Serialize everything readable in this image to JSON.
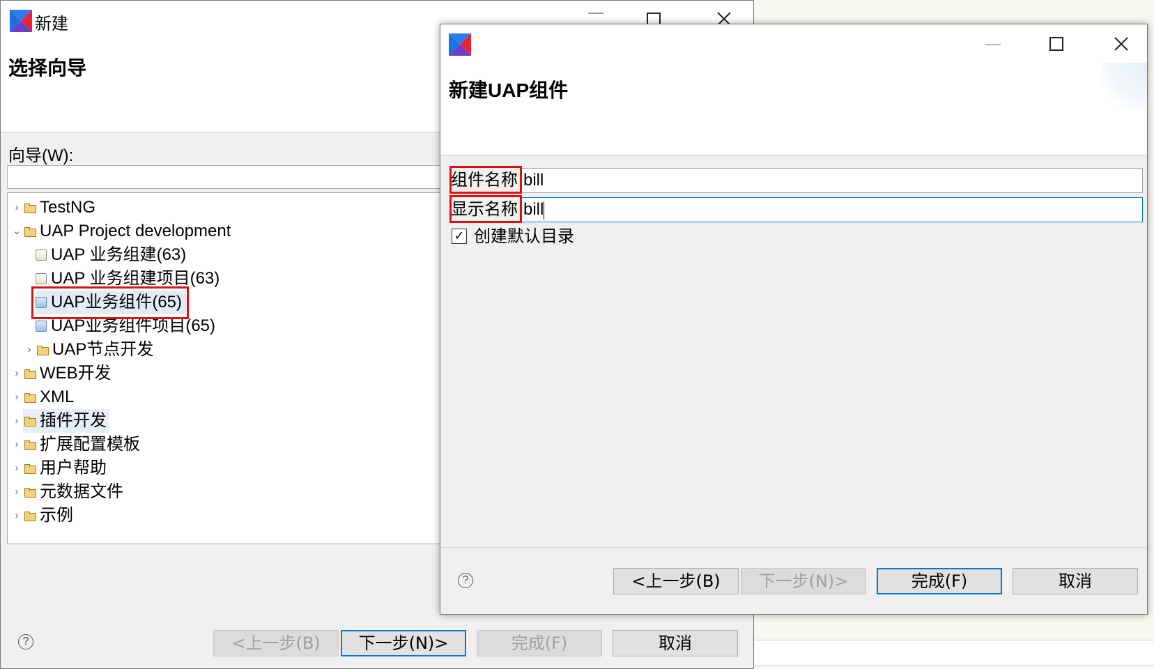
{
  "back_dialog": {
    "title": "新建",
    "heading": "选择向导",
    "filter_label": "向导(W):",
    "filter_value": "",
    "tree": [
      {
        "label": "TestNG",
        "expanded": false
      },
      {
        "label": "UAP Project development",
        "expanded": true
      },
      {
        "label": "UAP 业务组建(63)"
      },
      {
        "label": "UAP 业务组建项目(63)"
      },
      {
        "label": "UAP业务组件(65)",
        "selected": true
      },
      {
        "label": "UAP业务组件项目(65)"
      },
      {
        "label": "UAP节点开发",
        "expanded": false
      },
      {
        "label": "WEB开发",
        "expanded": false
      },
      {
        "label": "XML",
        "expanded": false
      },
      {
        "label": "插件开发",
        "expanded": false,
        "hover": true
      },
      {
        "label": "扩展配置模板",
        "expanded": false
      },
      {
        "label": "用户帮助",
        "expanded": false
      },
      {
        "label": "元数据文件",
        "expanded": false
      },
      {
        "label": "示例",
        "expanded": false
      }
    ],
    "buttons": {
      "back": "<上一步(B)",
      "next": "下一步(N)>",
      "finish": "完成(F)",
      "cancel": "取消"
    }
  },
  "front_dialog": {
    "heading": "新建UAP组件",
    "component_name_label": "组件名称",
    "component_name_value": "bill",
    "display_name_label": "显示名称",
    "display_name_value": "bill",
    "create_default_dir_label": "创建默认目录",
    "create_default_dir_checked": true,
    "buttons": {
      "back": "<上一步(B)",
      "next": "下一步(N)>",
      "finish": "完成(F)",
      "cancel": "取消"
    }
  },
  "help_glyph": "?",
  "icons": [
    "app-logo-icon",
    "minimize-icon",
    "maximize-icon",
    "close-icon",
    "folder-icon",
    "component-icon",
    "help-icon",
    "checkbox-check-icon"
  ],
  "colors": {
    "highlight_red": "#e01010",
    "focus_blue": "#0078d7",
    "selection_bg": "#e2ecf7"
  }
}
